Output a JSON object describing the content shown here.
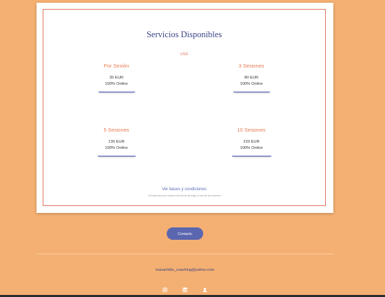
{
  "services": {
    "title": "Servicios Disponibles",
    "currency": "USD",
    "plans": [
      {
        "name": "Por Sesión",
        "price": "35 EUR",
        "mode": "100% Online"
      },
      {
        "name": "3 Sesiones",
        "price": "80 EUR",
        "mode": "100% Online"
      },
      {
        "name": "5 Sesiones",
        "price": "130 EUR",
        "mode": "100% Online"
      },
      {
        "name": "10 Sesiones",
        "price": "220 EUR",
        "mode": "100% Online"
      }
    ],
    "terms_link": "Ver bases y condiciones",
    "terms_note": "*Condiciones para conocer las formas de pago y reservar las sesiones"
  },
  "contact_button": "Contacto",
  "footer": {
    "email": "ivanachitto_coaching@yahoo.com",
    "social": [
      "instagram-icon",
      "linkedin-icon",
      "profile-icon"
    ]
  },
  "colors": {
    "background": "#f4b072",
    "accent": "#e0735a",
    "brand": "#3b4387",
    "button": "#5a66b0"
  }
}
